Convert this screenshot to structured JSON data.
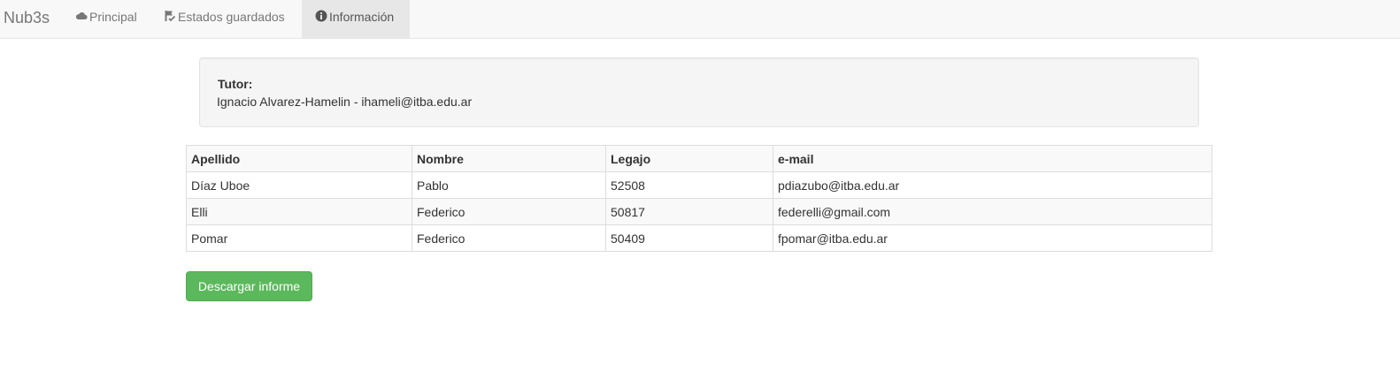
{
  "navbar": {
    "brand": "Nub3s",
    "items": [
      {
        "label": "Principal",
        "icon": "cloud-icon",
        "active": false
      },
      {
        "label": "Estados guardados",
        "icon": "saved-states-icon",
        "active": false
      },
      {
        "label": "Información",
        "icon": "info-icon",
        "active": true
      }
    ]
  },
  "tutor": {
    "label": "Tutor:",
    "value": "Ignacio Alvarez-Hamelin - ihameli@itba.edu.ar"
  },
  "table": {
    "headers": [
      "Apellido",
      "Nombre",
      "Legajo",
      "e-mail"
    ],
    "rows": [
      [
        "Díaz Uboe",
        "Pablo",
        "52508",
        "pdiazubo@itba.edu.ar"
      ],
      [
        "Elli",
        "Federico",
        "50817",
        "federelli@gmail.com"
      ],
      [
        "Pomar",
        "Federico",
        "50409",
        "fpomar@itba.edu.ar"
      ]
    ]
  },
  "actions": {
    "download_label": "Descargar informe"
  },
  "colors": {
    "navbar_bg": "#f8f8f8",
    "active_tab_bg": "#e7e7e7",
    "success": "#5cb85c"
  }
}
